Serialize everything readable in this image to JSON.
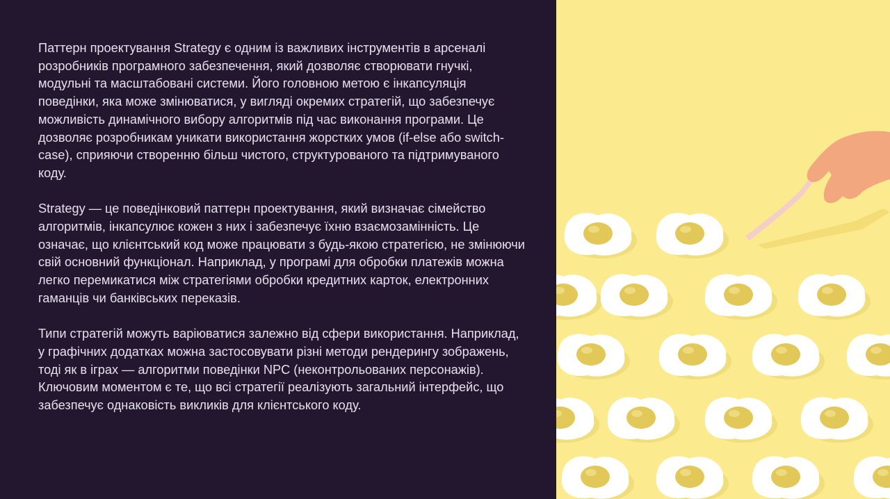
{
  "slide": {
    "paragraphs": [
      "Паттерн проектування Strategy є одним із важливих інструментів в арсеналі розробників програмного забезпечення, який дозволяє створювати гнучкі, модульні та масштабовані системи. Його головною метою є інкапсуляція поведінки, яка може змінюватися, у вигляді окремих стратегій, що забезпечує можливість динамічного вибору алгоритмів під час виконання програми. Це дозволяє розробникам уникати використання жорстких умов (if-else або switch-case), сприяючи створенню більш чистого, структурованого та підтримуваного коду.",
      "Strategy — це поведінковий паттерн проектування, який визначає сімейство алгоритмів, інкапсулює кожен з них і забезпечує їхню взаємозамінність. Це означає, що клієнтський код може працювати з будь-якою стратегією, не змінюючи свій основний функціонал. Наприклад, у програмі для обробки платежів можна легко перемикатися між стратегіями обробки кредитних карток, електронних гаманців чи банківських переказів.",
      "Типи стратегій можуть варіюватися залежно від сфери використання. Наприклад, у графічних додатках можна застосовувати різні методи рендерингу зображень, тоді як в іграх — алгоритми поведінки NPC (неконтрольованих персонажів). Ключовим моментом є те, що всі стратегії реалізують загальний інтерфейс, що забезпечує однаковість викликів для клієнтського коду."
    ]
  },
  "image": {
    "background_color": "#fbeb8e",
    "white_color": "#ffffff",
    "yolk_color": "#e2c858",
    "fork_color": "#f4cfc7",
    "hand_color": "#f3a77f"
  }
}
